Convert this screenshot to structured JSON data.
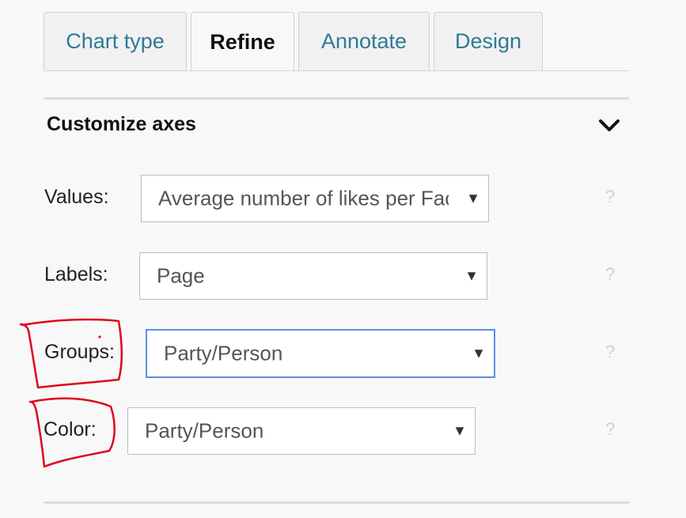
{
  "tabs": [
    {
      "label": "Chart type",
      "active": false
    },
    {
      "label": "Refine",
      "active": true
    },
    {
      "label": "Annotate",
      "active": false
    },
    {
      "label": "Design",
      "active": false
    }
  ],
  "section": {
    "title": "Customize axes"
  },
  "rows": [
    {
      "label": "Values:",
      "value": "Average number of likes per Facebook post"
    },
    {
      "label": "Labels:",
      "value": "Page"
    },
    {
      "label": "Groups:",
      "value": "Party/Person"
    },
    {
      "label": "Color:",
      "value": "Party/Person"
    }
  ],
  "help_glyph": "?",
  "arrow_glyph": "▼",
  "colors": {
    "tab_text": "#2e7a97",
    "focus_border": "#5b8fe0",
    "annotation": "#e0001b"
  }
}
